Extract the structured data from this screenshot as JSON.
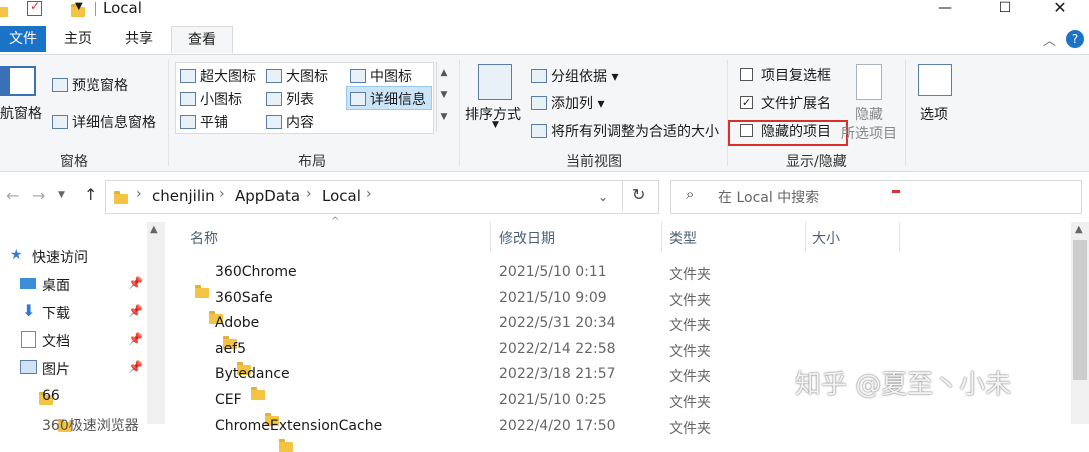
{
  "window": {
    "title": "Local",
    "controls": [
      "—",
      "☐",
      "✕"
    ]
  },
  "tabs": {
    "file": "文件",
    "home": "主页",
    "share": "共享",
    "view": "查看"
  },
  "ribbon": {
    "panes": {
      "nav_pane": "航窗格",
      "preview_pane": "预览窗格",
      "details_pane": "详细信息窗格",
      "group_label": "窗格"
    },
    "layout": {
      "xl_icons": "超大图标",
      "large_icons": "大图标",
      "medium_icons": "中图标",
      "small_icons": "小图标",
      "list": "列表",
      "details": "详细信息",
      "tiles": "平铺",
      "content": "内容",
      "group_label": "布局"
    },
    "current_view": {
      "sort_by": "排序方式",
      "group_by": "分组依据",
      "add_columns": "添加列",
      "size_columns": "将所有列调整为合适的大小",
      "group_label": "当前视图"
    },
    "show_hide": {
      "item_checkboxes": "项目复选框",
      "item_checkboxes_checked": false,
      "file_ext": "文件扩展名",
      "file_ext_checked": true,
      "hidden_items": "隐藏的项目",
      "hidden_items_checked": false,
      "hide_selected_1": "隐藏",
      "hide_selected_2": "所选项目",
      "group_label": "显示/隐藏"
    },
    "options": "选项"
  },
  "address": {
    "crumbs": [
      "chenjilin",
      "AppData",
      "Local"
    ]
  },
  "search": {
    "placeholder": "在 Local 中搜索"
  },
  "columns": {
    "name": "名称",
    "date": "修改日期",
    "type": "类型",
    "size": "大小"
  },
  "sidebar": {
    "quick_access": "快速访问",
    "items": [
      "桌面",
      "下载",
      "文档",
      "图片",
      "66",
      "360极速浏览器"
    ]
  },
  "files": [
    {
      "name": "360Chrome",
      "date": "2021/5/10 0:11",
      "type": "文件夹"
    },
    {
      "name": "360Safe",
      "date": "2021/5/10 9:09",
      "type": "文件夹"
    },
    {
      "name": "Adobe",
      "date": "2022/5/31 20:34",
      "type": "文件夹"
    },
    {
      "name": "aef5",
      "date": "2022/2/14 22:58",
      "type": "文件夹"
    },
    {
      "name": "Bytedance",
      "date": "2022/3/18 21:57",
      "type": "文件夹"
    },
    {
      "name": "CEF",
      "date": "2021/5/10 0:25",
      "type": "文件夹"
    },
    {
      "name": "ChromeExtensionCache",
      "date": "2022/4/20 17:50",
      "type": "文件夹"
    }
  ],
  "watermark": "知乎 @夏至丶小未"
}
